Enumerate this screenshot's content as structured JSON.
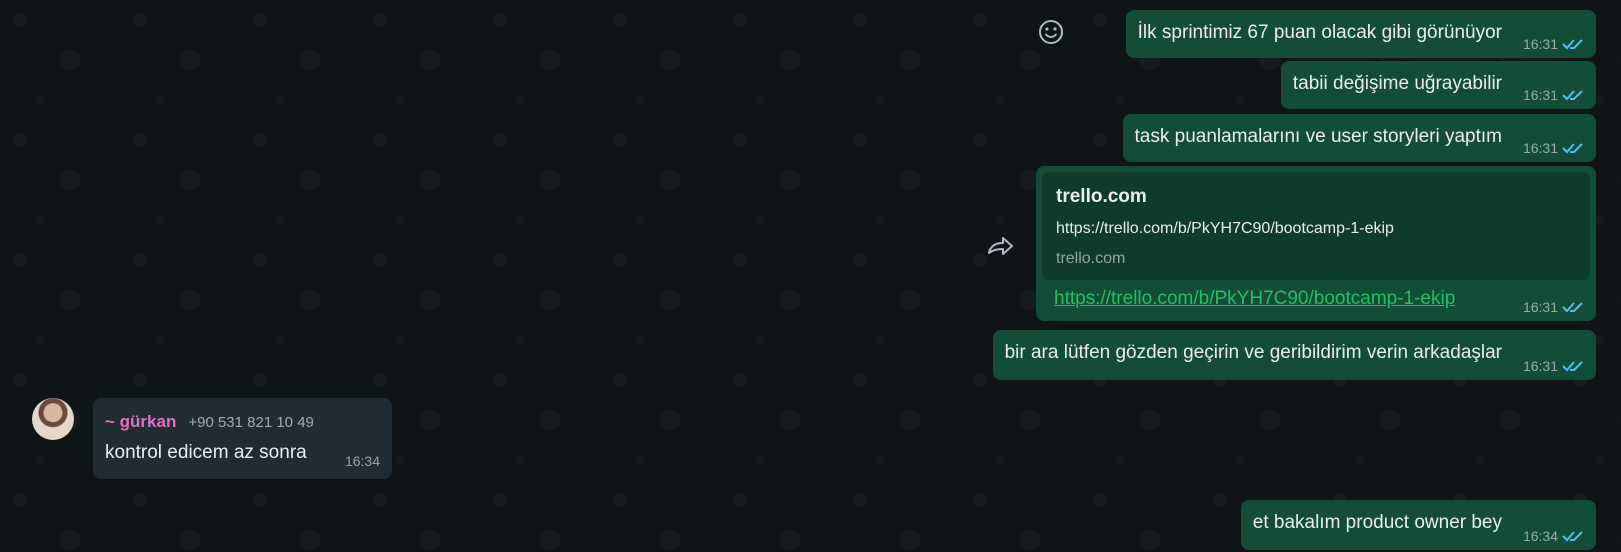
{
  "messages_out": [
    {
      "text": "İlk sprintimiz 67 puan olacak gibi görünüyor",
      "time": "16:31"
    },
    {
      "text": "tabii değişime uğrayabilir",
      "time": "16:31"
    },
    {
      "text": "task puanlamalarını ve user storyleri yaptım",
      "time": "16:31"
    },
    {
      "text": "bir ara lütfen gözden geçirin ve geribildirim verin arkadaşlar",
      "time": "16:31"
    },
    {
      "text": "et bakalım product owner bey",
      "time": "16:34"
    }
  ],
  "link_message": {
    "preview_title": "trello.com",
    "preview_url": "https://trello.com/b/PkYH7C90/bootcamp-1-ekip",
    "preview_domain": "trello.com",
    "link_text": "https://trello.com/b/PkYH7C90/bootcamp-1-ekip",
    "time": "16:31"
  },
  "incoming": {
    "sender_name": "~ gürkan",
    "sender_phone": "+90 531 821 10 49",
    "text": "kontrol edicem az sonra",
    "time": "16:34"
  },
  "colors": {
    "outgoing_bubble": "#144d37",
    "incoming_bubble": "#202c33",
    "read_ticks": "#53bdeb",
    "sender_name": "#e36fc5",
    "link": "#21c063"
  },
  "icons": {
    "emoji": "emoji-smile-icon",
    "forward": "forward-icon",
    "read_status": "double-check-icon"
  }
}
